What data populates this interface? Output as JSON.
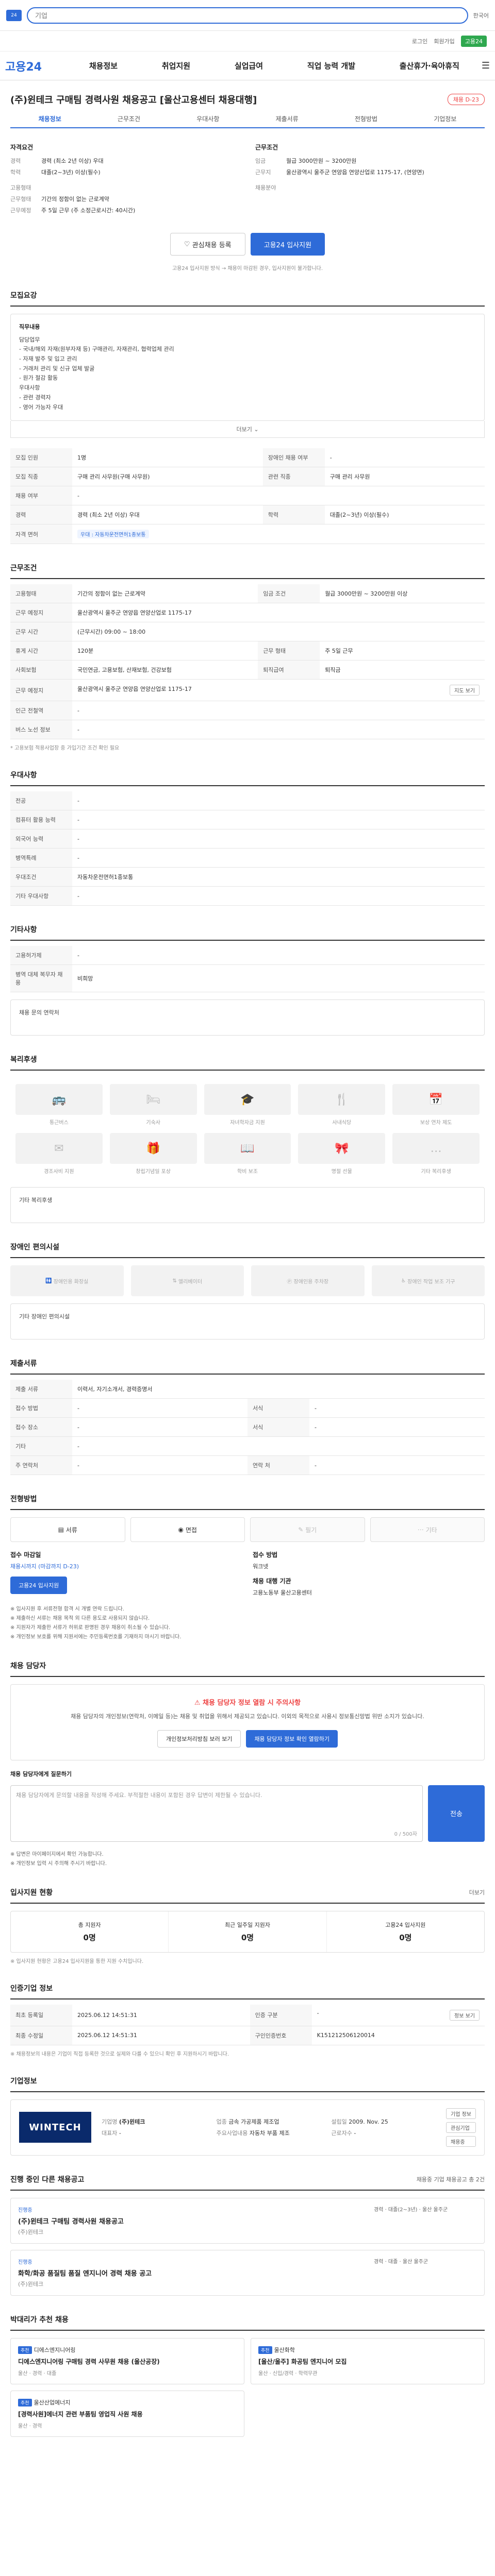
{
  "topbar": {
    "search_placeholder": "기업",
    "lang": "한국어"
  },
  "util": {
    "login": "로그인",
    "join": "회원가입",
    "green": "고용24"
  },
  "gnb": {
    "brand": "고용24",
    "menu": [
      "채용정보",
      "취업지원",
      "실업급여",
      "직업 능력 개발",
      "출산휴가·육아휴직"
    ]
  },
  "job": {
    "title": "(주)윈테크 구매팀 경력사원 채용공고 [울산고용센터 채용대행]",
    "badge": "채용 D-23",
    "tabs": [
      "채용정보",
      "근무조건",
      "우대사항",
      "제출서류",
      "전형방법",
      "기업정보"
    ]
  },
  "summary": {
    "left_title": "자격요건",
    "left": [
      {
        "k": "경력",
        "v": "경력 (최소 2년 이상) 우대"
      },
      {
        "k": "학력",
        "v": "대졸(2~3년) 이상(필수)"
      },
      {
        "k": "고용형태",
        "v": ""
      },
      {
        "k": "근무형태",
        "v": "기간의 정함이 없는 근로계약"
      },
      {
        "k": "근무예정",
        "v": "주 5일 근무 (주 소정근로시간: 40시간)"
      }
    ],
    "right_title": "근무조건",
    "right": [
      {
        "k": "임금",
        "v": "월급 3000만원 ~ 3200만원"
      },
      {
        "k": "근무지",
        "v": "울산광역시 울주군 연양읍 연양산업로 1175-17, (연양면)"
      },
      {
        "k": "채용분야",
        "v": ""
      }
    ]
  },
  "buttons": {
    "bookmark": "관심채용 등록",
    "apply": "고용24 입사지원"
  },
  "note": "고용24 입사지원 방식 → 채용이 마감된 경우, 입사지원이 불가합니다.",
  "recruit": {
    "title": "모집요강",
    "duty_title": "직무내용",
    "duty_lines": [
      "담당업무",
      "- 국내/해외 자재(원부자재 등) 구매관리, 자재관리, 협력업체 관리",
      "- 자재 발주 및 입고 관리",
      "- 거래처 관리 및 신규 업체 발굴",
      "- 원가 절감 활동",
      "우대사항",
      "- 관련 경력자",
      "- 영어 가능자 우대"
    ],
    "more": "더보기",
    "rows": [
      {
        "k": "모집 인원",
        "v": "1명",
        "k2": "장애인 채용 여부",
        "v2": "-"
      },
      {
        "k": "모집 직종",
        "v": "구매 관리 사무원(구매 사무원)",
        "k2": "관련 직종",
        "v2": "구매 관리 사무원"
      },
      {
        "k": "채용 여부",
        "v": "-",
        "k2": "",
        "v2": ""
      },
      {
        "k": "경력",
        "v": "경력 (최소 2년 이상) 우대",
        "k2": "학력",
        "v2": "대졸(2~3년) 이상(필수)"
      },
      {
        "k": "자격 면허",
        "v": "우대 : 자동차운전면허1종보통",
        "k2": "",
        "v2": ""
      }
    ]
  },
  "work": {
    "title": "근무조건",
    "rows": [
      {
        "k": "고용형태",
        "v": "기간의 정함이 없는 근로계약",
        "k2": "임금 조건",
        "v2": "월급 3000만원 ~ 3200만원 이상"
      },
      {
        "k": "근무 예정지",
        "v": "울산광역시 울주군 연양읍 연양산업로 1175-17",
        "k2": "",
        "v2": ""
      },
      {
        "k": "근무 시간",
        "v": "(근무시간) 09:00 ~ 18:00",
        "k2": "",
        "v2": ""
      },
      {
        "k": "휴게 시간",
        "v": "120분",
        "k2": "근무 형태",
        "v2": "주 5일 근무"
      },
      {
        "k": "사회보험",
        "v": "국민연금, 고용보험, 산재보험, 건강보험",
        "k2": "퇴직급여",
        "v2": "퇴직금"
      },
      {
        "k": "근무 예정지",
        "v": "울산광역시 울주군 연양읍 연양산업로 1175-17",
        "k2": "",
        "v2": ""
      },
      {
        "k": "인근 전철역",
        "v": "-",
        "k2": "",
        "v2": ""
      },
      {
        "k": "버스 노선 정보",
        "v": "-",
        "k2": "",
        "v2": ""
      }
    ],
    "map_btn": "지도 보기",
    "note": "* 고용보험 적용사업장 중 가입기간 조건 확인 필요"
  },
  "prefer": {
    "title": "우대사항",
    "rows": [
      {
        "k": "전공",
        "v": "-"
      },
      {
        "k": "컴퓨터 활용 능력",
        "v": "-"
      },
      {
        "k": "외국어 능력",
        "v": "-"
      },
      {
        "k": "병역특례",
        "v": "-"
      },
      {
        "k": "우대조건",
        "v": "자동차운전면허1종보통"
      },
      {
        "k": "기타 우대사항",
        "v": "-"
      }
    ]
  },
  "etc": {
    "title": "기타사항",
    "rows": [
      {
        "k": "고용허가제",
        "v": "-"
      },
      {
        "k": "병역 대체 복무자 채용",
        "v": "비희망"
      }
    ],
    "contact_label": "채용 문의 연락처"
  },
  "welfare": {
    "title": "복리후생",
    "items": [
      "통근버스",
      "기숙사",
      "자녀학자금 지원",
      "사내식당",
      "보상 연차 제도",
      "경조사비 지원",
      "창립기념일 포상",
      "학비 보조",
      "명절 선물",
      "기타 복리후생"
    ],
    "etc_label": "기타 복리후생"
  },
  "disabled": {
    "title": "장애인 편의시설",
    "items": [
      "장애인용 화장실",
      "엘리베이터",
      "장애인용 주차장",
      "장애인 작업 보조 기구"
    ],
    "etc_label": "기타 장애인 편의시설"
  },
  "docs": {
    "title": "제출서류",
    "rows": [
      {
        "k": "제출 서류",
        "v": "이력서, 자기소개서, 경력증명서",
        "k2": "",
        "v2": ""
      },
      {
        "k": "접수 방법",
        "v": "-",
        "k2": "서식",
        "v2": "-"
      },
      {
        "k": "접수 장소",
        "v": "-",
        "k2": "서식",
        "v2": "-"
      },
      {
        "k": "기타",
        "v": "-",
        "k2": "",
        "v2": ""
      },
      {
        "k": "주 연락처",
        "v": "-",
        "k2": "연락 처",
        "v2": "-"
      }
    ]
  },
  "selection": {
    "title": "전형방법",
    "methods": [
      "서류",
      "면접",
      "필기",
      "기타"
    ],
    "period_label": "접수 마감일",
    "period": "채용시까지 (마감까지 D-23)",
    "site_label": "접수 방법",
    "site": "워크넷",
    "contact_label": "채용 대행 기관",
    "contact": "고용노동부 울산고용센터",
    "apply_btn": "고용24 입사지원",
    "notes": [
      "※ 입사지원 후 서류전형 합격 시 개별 연락 드립니다.",
      "※ 제출하신 서류는 채용 목적 외 다른 용도로 사용되지 않습니다.",
      "※ 지원자가 제출한 서류가 허위로 판명된 경우 채용이 취소될 수 있습니다.",
      "※ 개인정보 보호를 위해 지원서에는 주민등록번호를 기재하지 마시기 바랍니다."
    ]
  },
  "contact": {
    "title": "채용 담당자",
    "alert_title": "채용 담당자 정보 열람 시 주의사항",
    "alert_desc": "채용 담당자의 개인정보(연락처, 이메일 등)는 채용 및 취업을 위해서 제공되고 있습니다. 이외의 목적으로 사용시 정보통신망법 위반 소지가 있습니다.",
    "btn1": "개인정보처리방침 보러 보기",
    "btn2": "채용 담당자 정보 확인 열람하기",
    "q_label": "채용 담당자에게 질문하기",
    "q_placeholder": "채용 담당자에게 문의할 내용을 작성해 주세요. 부적절한 내용이 포함된 경우 답변이 제한될 수 있습니다.",
    "q_count": "0 / 500자",
    "send": "전송",
    "q_notes": [
      "※ 답변은 마이페이지에서 확인 가능합니다.",
      "※ 개인정보 입력 시 주의해 주시기 바랍니다."
    ]
  },
  "stats": {
    "title": "입사지원 현황",
    "link": "더보기",
    "items": [
      {
        "label": "총 지원자",
        "value": "0명"
      },
      {
        "label": "최근 일주일 지원자",
        "value": "0명"
      },
      {
        "label": "고용24 입사지원",
        "value": "0명"
      }
    ],
    "note": "※ 입사지원 현황은 고용24 입사지원을 통한 지원 수치입니다."
  },
  "regist": {
    "title": "인증기업 정보",
    "rows": [
      {
        "k": "최초 등록일",
        "v": "2025.06.12 14:51:31",
        "k2": "인증 구분",
        "v2": "-"
      },
      {
        "k": "최종 수정일",
        "v": "2025.06.12 14:51:31",
        "k2": "구인인증번호",
        "v2": "K151212506120014"
      }
    ],
    "btn": "정보 보기",
    "note": "※ 채용정보의 내용은 기업이 직접 등록한 것으로 실제와 다를 수 있으니 확인 후 지원하시기 바랍니다."
  },
  "company": {
    "title": "기업정보",
    "logo": "WINTECH",
    "info": [
      {
        "k": "기업명",
        "v": "(주)윈테크"
      },
      {
        "k": "업종",
        "v": "금속 가공제품 제조업"
      },
      {
        "k": "설립일",
        "v": "2009. Nov. 25"
      },
      {
        "k": "대표자",
        "v": "-"
      },
      {
        "k": "주요사업내용",
        "v": "자동차 부품 제조"
      },
      {
        "k": "근로자수",
        "v": "-"
      }
    ],
    "btn1": "기업 정보",
    "btn2": "관심기업",
    "btn3": "채용중"
  },
  "related": {
    "title": "진행 중인 다른 채용공고",
    "link": "채용중 기업 채용공고 총 2건",
    "items": [
      {
        "tag": "진행중",
        "title": "(주)윈테크 구매팀 경력사원 채용공고",
        "company": "(주)윈테크",
        "info": "경력 · 대졸(2~3년) · 울산 울주군"
      },
      {
        "tag": "진행중",
        "title": "화학/화공 품질팀 품질 엔지니어 경력 채용 공고",
        "company": "(주)윈테크",
        "info": "경력 · 대졸 · 울산 울주군"
      }
    ]
  },
  "recommend": {
    "title": "박대리가 추천 채용",
    "items": [
      {
        "tag": "추천",
        "company": "디에스엔지니어링",
        "title": "디에스엔지니어링 구매팀 경력 사무원 채용 (울산공장)",
        "meta": "울산 · 경력 · 대졸"
      },
      {
        "tag": "추천",
        "company": "울산화학",
        "title": "[울산/울주] 화공팀 엔지니어 모집",
        "meta": "울산 · 신입/경력 · 학력무관"
      },
      {
        "tag": "추천",
        "company": "울산산업에너지",
        "title": "[경력사원]에너지 관련 부품팀 영업직 사원 채용",
        "meta": "울산 · 경력"
      }
    ]
  },
  "colors": {
    "accent": "#2e6bd8",
    "alert": "#e44444",
    "green": "#2fa84f"
  }
}
